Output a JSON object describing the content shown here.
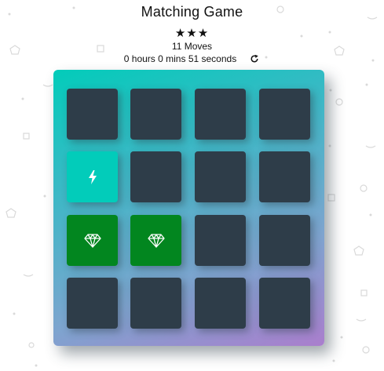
{
  "title": "Matching Game",
  "stars": "★★★",
  "moves_text": "11 Moves",
  "timer_text": "0 hours 0 mins 51 seconds",
  "restart_icon": "restart-icon",
  "colors": {
    "card_closed": "#2e3d49",
    "card_open": "#02ccba",
    "card_match": "#02861f",
    "deck_gradient_start": "#02ccba",
    "deck_gradient_end": "#aa7ecd"
  },
  "cards": [
    {
      "state": "closed",
      "icon": ""
    },
    {
      "state": "closed",
      "icon": ""
    },
    {
      "state": "closed",
      "icon": ""
    },
    {
      "state": "closed",
      "icon": ""
    },
    {
      "state": "open",
      "icon": "bolt-icon"
    },
    {
      "state": "closed",
      "icon": ""
    },
    {
      "state": "closed",
      "icon": ""
    },
    {
      "state": "closed",
      "icon": ""
    },
    {
      "state": "match",
      "icon": "diamond-icon"
    },
    {
      "state": "match",
      "icon": "diamond-icon"
    },
    {
      "state": "closed",
      "icon": ""
    },
    {
      "state": "closed",
      "icon": ""
    },
    {
      "state": "closed",
      "icon": ""
    },
    {
      "state": "closed",
      "icon": ""
    },
    {
      "state": "closed",
      "icon": ""
    },
    {
      "state": "closed",
      "icon": ""
    }
  ]
}
